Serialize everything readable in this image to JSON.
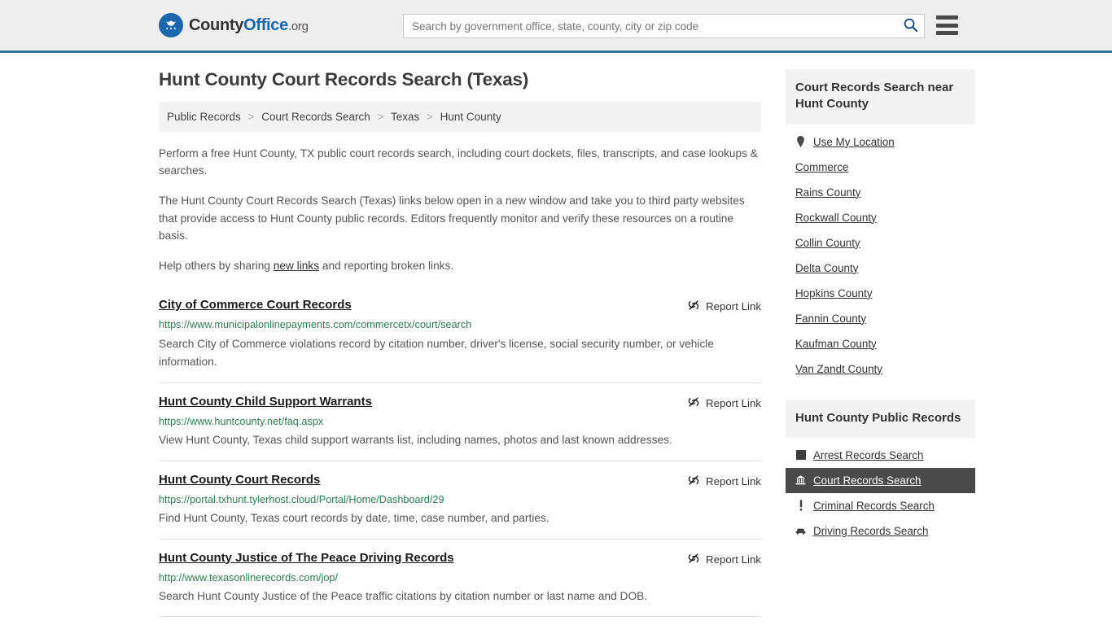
{
  "header": {
    "logo": {
      "part1": "County",
      "part2": "Office",
      "suffix": ".org",
      "icon": "eagle-seal-icon"
    },
    "search": {
      "placeholder": "Search by government office, state, county, city or zip code",
      "value": "",
      "button_icon": "search-icon"
    },
    "menu_icon": "hamburger-menu-icon",
    "accent_color": "#31719b"
  },
  "main": {
    "title": "Hunt County Court Records Search (Texas)",
    "breadcrumb": [
      {
        "label": "Public Records",
        "current": false
      },
      {
        "label": "Court Records Search",
        "current": false
      },
      {
        "label": "Texas",
        "current": false
      },
      {
        "label": "Hunt County",
        "current": true
      }
    ],
    "breadcrumb_separator": ">",
    "intro": {
      "p1": "Perform a free Hunt County, TX public court records search, including court dockets, files, transcripts, and case lookups & searches.",
      "p2": "The Hunt County Court Records Search (Texas) links below open in a new window and take you to third party websites that provide access to Hunt County public records. Editors frequently monitor and verify these resources on a routine basis.",
      "p3_before": "Help others by sharing ",
      "p3_link": "new links",
      "p3_after": " and reporting broken links."
    },
    "report_link_label": "Report Link",
    "report_link_icon": "broken-link-icon",
    "results": [
      {
        "title": "City of Commerce Court Records",
        "url": "https://www.municipalonlinepayments.com/commercetx/court/search",
        "description": "Search City of Commerce violations record by citation number, driver's license, social security number, or vehicle information."
      },
      {
        "title": "Hunt County Child Support Warrants",
        "url": "https://www.huntcounty.net/faq.aspx",
        "description": "View Hunt County, Texas child support warrants list, including names, photos and last known addresses."
      },
      {
        "title": "Hunt County Court Records",
        "url": "https://portal.txhunt.tylerhost.cloud/Portal/Home/Dashboard/29",
        "description": "Find Hunt County, Texas court records by date, time, case number, and parties."
      },
      {
        "title": "Hunt County Justice of The Peace Driving Records",
        "url": "http://www.texasonlinerecords.com/jop/",
        "description": "Search Hunt County Justice of the Peace traffic citations by citation number or last name and DOB."
      }
    ]
  },
  "sidebar": {
    "nearby": {
      "heading": "Court Records Search near Hunt County",
      "items": [
        {
          "label": "Use My Location",
          "icon": "map-pin-icon"
        },
        {
          "label": "Commerce",
          "icon": ""
        },
        {
          "label": "Rains County",
          "icon": ""
        },
        {
          "label": "Rockwall County",
          "icon": ""
        },
        {
          "label": "Collin County",
          "icon": ""
        },
        {
          "label": "Delta County",
          "icon": ""
        },
        {
          "label": "Hopkins County",
          "icon": ""
        },
        {
          "label": "Fannin County",
          "icon": ""
        },
        {
          "label": "Kaufman County",
          "icon": ""
        },
        {
          "label": "Van Zandt County",
          "icon": ""
        }
      ]
    },
    "public_records": {
      "heading": "Hunt County Public Records",
      "active_highlight_color": "#4a4a4a",
      "items": [
        {
          "label": "Arrest Records Search",
          "icon": "square-icon",
          "active": false
        },
        {
          "label": "Court Records Search",
          "icon": "courthouse-icon",
          "active": true
        },
        {
          "label": "Criminal Records Search",
          "icon": "exclamation-icon",
          "active": false
        },
        {
          "label": "Driving Records Search",
          "icon": "car-icon",
          "active": false
        }
      ]
    }
  }
}
